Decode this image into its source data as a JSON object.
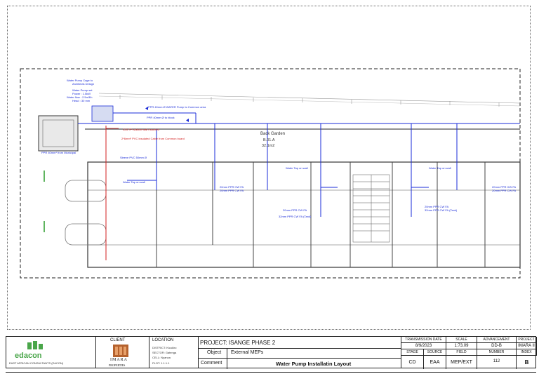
{
  "drawing": {
    "room_title": "Back Garden",
    "room_code": "B.01.A",
    "room_area": "32.1m2",
    "pump_note": [
      "Water Pump Cage to",
      "Architects Design"
    ],
    "pump_spec": [
      "Water Pump set",
      "Power : 1.5kW",
      "Water flow : 2.5m3/h",
      "Head : 30 mm"
    ],
    "labels_blue": [
      "PPR 40mm Ø WATER Pump to Common area",
      "PPR 40mm Ø to block",
      "PPR 40mm* from Municipal",
      "Sleeve PVC 50mm Ø",
      "Water Tap on wall",
      "Water Tap on wall",
      "20mm PPR HW FA",
      "20mm PPR CW FA",
      "20mm PPR CW FA",
      "32mm PPR CW FA (Tank)",
      "20mm PPR HW FA",
      "20mm PPR CW FA",
      "20mm PPR CW FA",
      "32mm PPR CW FA (Tank)",
      "Water Tap on wall"
    ],
    "labels_red": [
      "32A TP Isolator wall mounted",
      "2*6mm² PVC insulated Cable from Common board"
    ]
  },
  "titleblock": {
    "logo_text": "edacon",
    "logo_sub": "EAST AFRICAN CONSULTANTS (EACON)",
    "client_label": "CLIENT",
    "client_name": "IMARA",
    "client_sub": "PROPERTIES",
    "location_label": "LOCATION",
    "location_rows": [
      "DISTRICT: Kicukiro",
      "SECTOR: Gatenga",
      "CELL: Nyanza",
      "PLOT: 1.1.1.1"
    ],
    "project": "PROJECT: ISANGE PHASE 2",
    "object_label": "Object",
    "object_value": "External MEPs",
    "comment_label": "Comment",
    "comment_value": "Water Pump Installatin Layout",
    "table": {
      "transmission_date_label": "TRANSMISSION DATE",
      "transmission_date": "8/9/2023",
      "scale_label": "SCALE",
      "scale": "1:73.09",
      "advancement_label": "ADVANCEMENT",
      "advancement": "DD-B",
      "project_label": "PROJECT",
      "project": "IMARA II",
      "stage_label": "STAGE",
      "source_label": "SOURCE",
      "field_label": "FIELD",
      "number_label": "NUMBER",
      "index_label": "INDEX",
      "stage": "CD",
      "source": "EAA",
      "field": "MEP/EXT",
      "number": "112",
      "index": "B"
    }
  }
}
